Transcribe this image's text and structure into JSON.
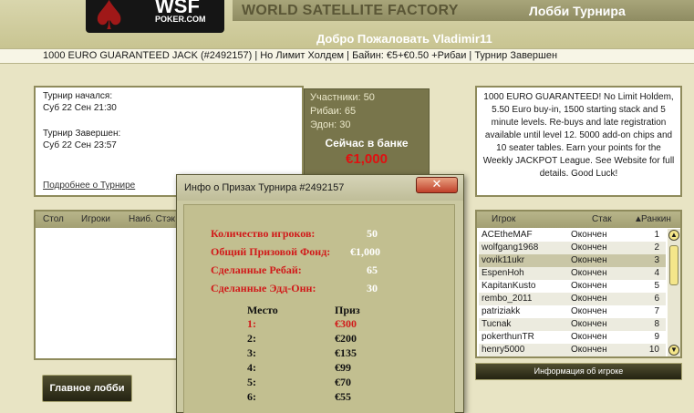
{
  "header": {
    "logo_text": "WSF",
    "logo_sub": "POKER.COM",
    "factory_title": "WORLD SATELLITE FACTORY",
    "lobby_title": "Лобби Турнира",
    "welcome": "Добро Пожаловать Vladimir11"
  },
  "info_bar": "1000 EURO GUARANTEED JACK (#2492157)  |  Но Лимит Холдем  |  Байин: €5+€0.50 +Рибаи  |  Турнир Завершен",
  "times": {
    "started_label": "Турнир начался:",
    "started_value": "Суб 22 Сен 21:30",
    "ended_label": "Турнир Завершен:",
    "ended_value": "Суб 22 Сен 23:57",
    "more_link": "Подробнее о Турнире"
  },
  "prize_box": {
    "participants": "Участники: 50",
    "rebuys": "Рибаи: 65",
    "addons": "Эдон: 30",
    "bank_label": "Сейчас в банке",
    "bank_value": "€1,000"
  },
  "description": "1000 EURO GUARANTEED! No Limit Holdem, 5.50 Euro buy-in, 1500 starting stack and 5 minute levels. Re-buys and late registration available until level 12. 5000 add-on chips and 10 seater tables. Earn your points for the Weekly JACKPOT League. See Website for full details. Good Luck!",
  "tables_panel": {
    "headers": [
      "Стол",
      "Игроки",
      "Наиб. Стэк"
    ]
  },
  "main_lobby_button": "Главное лобби",
  "players_panel": {
    "headers": [
      "Игрок",
      "Стак",
      "Ранкин"
    ],
    "sort_indicator": "▲",
    "rows": [
      {
        "name": "ACEtheMAF",
        "stack": "Окончен",
        "rank": "1"
      },
      {
        "name": "wolfgang1968",
        "stack": "Окончен",
        "rank": "2"
      },
      {
        "name": "vovik11ukr",
        "stack": "Окончен",
        "rank": "3"
      },
      {
        "name": "EspenHoh",
        "stack": "Окончен",
        "rank": "4"
      },
      {
        "name": "KapitanKusto",
        "stack": "Окончен",
        "rank": "5"
      },
      {
        "name": "rembo_2011",
        "stack": "Окончен",
        "rank": "6"
      },
      {
        "name": "patriziakk",
        "stack": "Окончен",
        "rank": "7"
      },
      {
        "name": "Tucnak",
        "stack": "Окончен",
        "rank": "8"
      },
      {
        "name": "pokerthunTR",
        "stack": "Окончен",
        "rank": "9"
      },
      {
        "name": "henry5000",
        "stack": "Окончен",
        "rank": "10"
      }
    ],
    "info_button": "Информация об игроке"
  },
  "dialog": {
    "title": "Инфо о Призах Турнира #2492157",
    "close_glyph": "✕",
    "stats": [
      {
        "label": "Количество игроков:",
        "value": "50"
      },
      {
        "label": "Общий Призовой Фонд:",
        "value": "€1,000"
      },
      {
        "label": "Сделанные Ребай:",
        "value": "65"
      },
      {
        "label": "Сделанные Эдд-Онн:",
        "value": "30"
      }
    ],
    "place_header": "Место",
    "prize_header": "Приз",
    "payouts": [
      {
        "place": "1:",
        "prize": "€300"
      },
      {
        "place": "2:",
        "prize": "€200"
      },
      {
        "place": "3:",
        "prize": "€135"
      },
      {
        "place": "4:",
        "prize": "€99"
      },
      {
        "place": "5:",
        "prize": "€70"
      },
      {
        "place": "6:",
        "prize": "€55"
      }
    ]
  },
  "colors": {
    "accent_red": "#e01010",
    "panel_olive": "#78754b"
  }
}
